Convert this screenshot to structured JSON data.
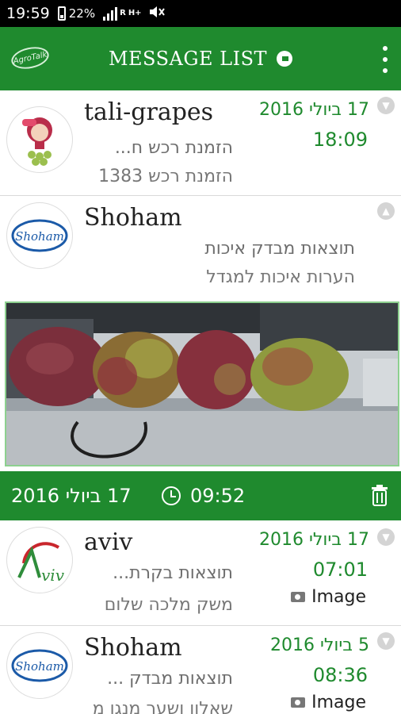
{
  "status_bar": {
    "time": "19:59",
    "battery": "22%",
    "network": "H+",
    "roaming": "R"
  },
  "app_bar": {
    "logo": "AgroTalk",
    "title": "MESSAGE LIST"
  },
  "messages": [
    {
      "sender": "tali-grapes",
      "preview_line1": "הזמנת רכש ח...",
      "preview_line2": "הזמנת רכש 1383",
      "date": "17 ביולי 2016",
      "time": "18:09",
      "expanded": false
    },
    {
      "sender": "Shoham",
      "preview_line1": "תוצאות מבדק איכות",
      "preview_line2": "הערות איכות למגדל",
      "expanded": true,
      "detail": {
        "date": "17 ביולי 2016",
        "time": "09:52"
      }
    },
    {
      "sender": "aviv",
      "preview_line1": "תוצאות בקרת...",
      "preview_line2": "משק מלכה שלום",
      "date": "17 ביולי 2016",
      "time": "07:01",
      "attachment": "Image",
      "expanded": false
    },
    {
      "sender": "Shoham",
      "preview_line1": "תוצאות מבדק ...",
      "preview_line2": "שאלוו ושער מנגו מ",
      "date": "5 ביולי 2016",
      "time": "08:36",
      "attachment": "Image",
      "expanded": false
    }
  ],
  "colors": {
    "primary": "#1f8a2e",
    "accent_text": "#1f8a2e",
    "border": "#8dd08f"
  },
  "avatars": {
    "tali": "Tali",
    "shoham": "Shoham",
    "aviv": "Aviv"
  }
}
